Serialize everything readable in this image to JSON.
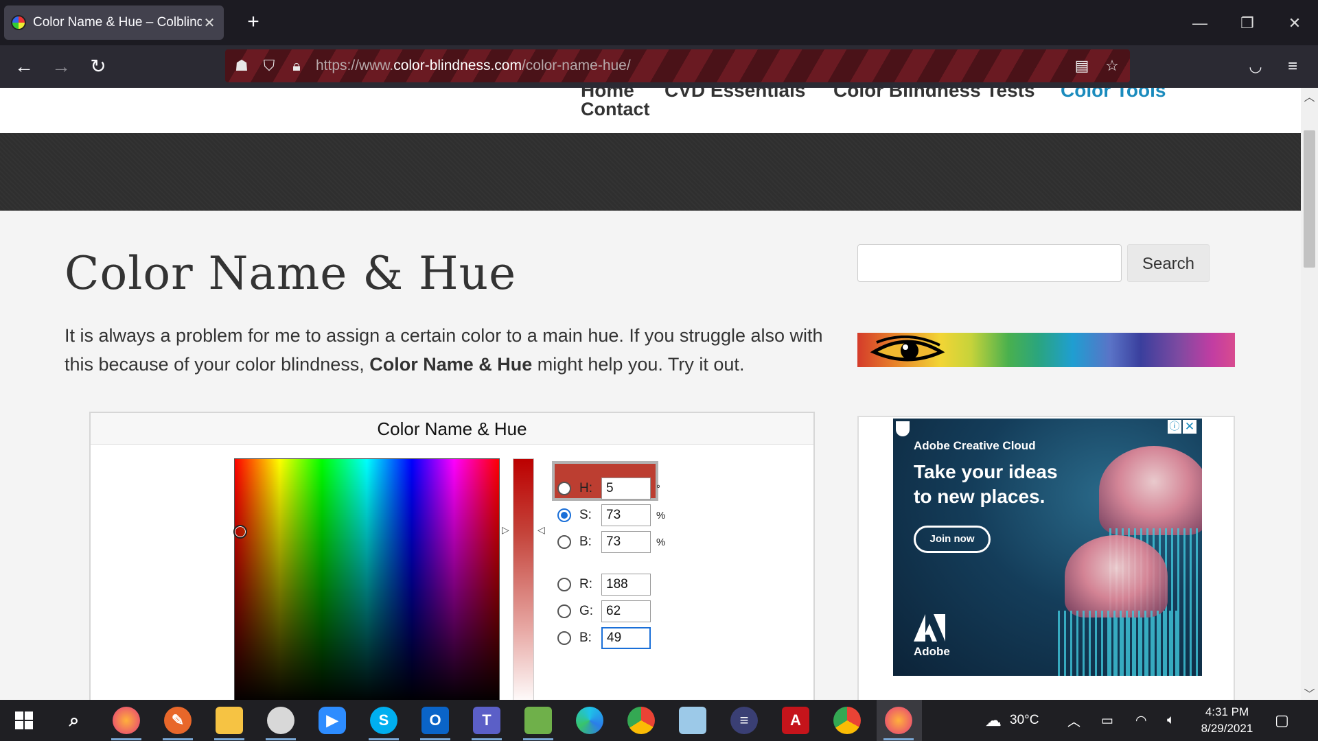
{
  "browser": {
    "tab_title": "Color Name & Hue – Colblindor",
    "url_prefix": "https://www.",
    "url_host": "color-blindness.com",
    "url_path": "/color-name-hue/",
    "icons": [
      "back-arrow-icon",
      "forward-arrow-icon",
      "reload-icon",
      "tracking-protection-icon",
      "shield-icon",
      "lock-icon",
      "reader-view-icon",
      "bookmark-star-icon",
      "pocket-icon",
      "hamburger-menu-icon"
    ]
  },
  "site": {
    "nav_partial": [
      "Home",
      "CVD Essentials",
      "Color Blindness Tests",
      "Color Tools"
    ],
    "nav_contact": "Contact"
  },
  "content": {
    "heading": "Color Name & Hue",
    "intro_part1": "It is always a problem for me to assign a certain color to a main hue. If you struggle also with this because of your color blindness, ",
    "intro_bold": "Color Name & Hue",
    "intro_part2": " might help you. Try it out."
  },
  "sidebar": {
    "search_button": "Search",
    "search_placeholder": ""
  },
  "ad": {
    "brand": "Adobe Creative Cloud",
    "headline": "Take your ideas to new places.",
    "cta": "Join now",
    "logo_text": "Adobe"
  },
  "widget": {
    "title": "Color Name & Hue",
    "swatch_color": "#bc3e31",
    "fields": [
      {
        "label": "H:",
        "value": "5",
        "unit": "°",
        "checked": false
      },
      {
        "label": "S:",
        "value": "73",
        "unit": "%",
        "checked": true
      },
      {
        "label": "B:",
        "value": "73",
        "unit": "%",
        "checked": false
      },
      {
        "label": "R:",
        "value": "188",
        "unit": "",
        "checked": false
      },
      {
        "label": "G:",
        "value": "62",
        "unit": "",
        "checked": false
      },
      {
        "label": "B:",
        "value": "49",
        "unit": "",
        "checked": false
      }
    ]
  },
  "taskbar": {
    "weather": "30°C",
    "time": "4:31 PM",
    "date": "8/29/2021"
  }
}
